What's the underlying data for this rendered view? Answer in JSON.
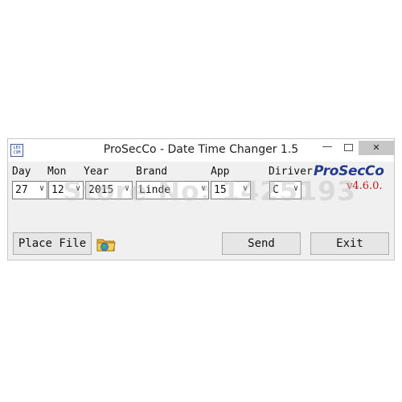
{
  "window": {
    "title": "ProSecCo - Date Time Changer 1.5",
    "icon_text": "LEX COM",
    "controls": {
      "minimize": "—",
      "close": "✕"
    }
  },
  "labels": {
    "day": "Day",
    "mon": "Mon",
    "year": "Year",
    "brand": "Brand",
    "app": "App",
    "driver": "Diriver"
  },
  "fields": {
    "day": "27",
    "mon": "12",
    "year": "2015",
    "brand": "Linde",
    "app": "15",
    "driver": "C"
  },
  "brand_logo": {
    "name": "ProSecCo",
    "version": "v4.6.0."
  },
  "buttons": {
    "place_file": "Place File",
    "send": "Send",
    "exit": "Exit"
  },
  "watermark": "Store No: 1425193",
  "colors": {
    "logo": "#243a8c",
    "version": "#c01818",
    "window_bg": "#f0f0f0"
  },
  "icons": {
    "app": "lexcom-app-icon",
    "folder": "folder-globe-icon",
    "dropdown": "chevron-down-icon"
  }
}
